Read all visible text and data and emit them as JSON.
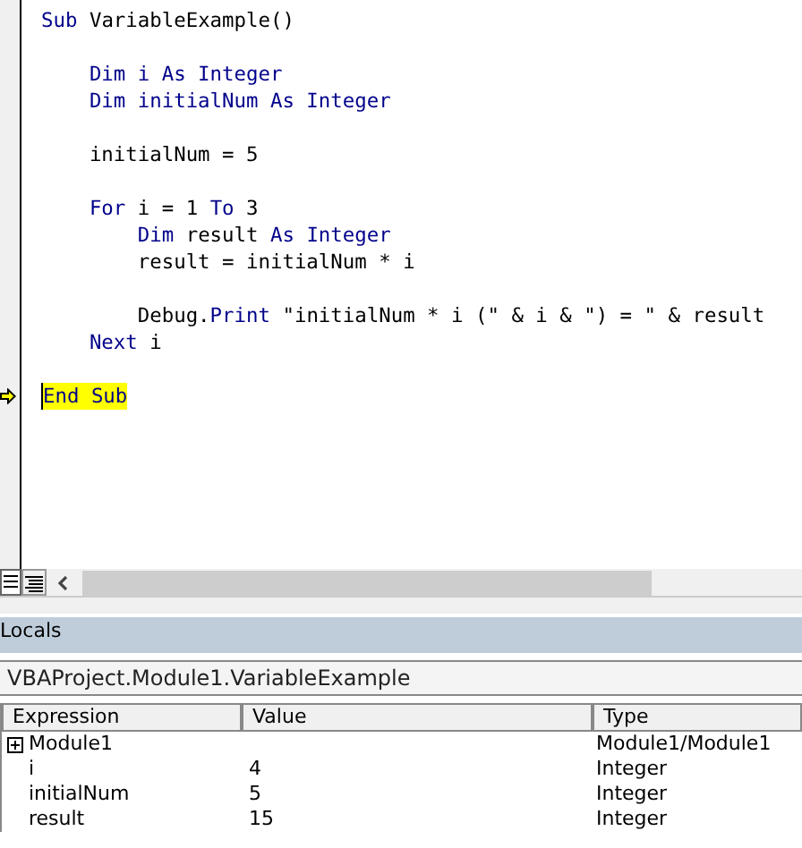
{
  "code_lines": [
    {
      "tokens": [
        {
          "text": "Sub",
          "kind": "kw"
        },
        {
          "text": " VariableExample()",
          "kind": "id"
        }
      ],
      "current": false
    },
    {
      "current": false
    },
    {
      "tokens": [
        {
          "text": "    Dim i As Integer",
          "kind": "kw"
        }
      ],
      "current": false
    },
    {
      "tokens": [
        {
          "text": "    Dim initialNum As Integer",
          "kind": "kw"
        }
      ],
      "current": false
    },
    {
      "current": false
    },
    {
      "tokens": [
        {
          "text": "    initialNum = 5",
          "kind": "id"
        }
      ],
      "current": false
    },
    {
      "current": false
    },
    {
      "tokens": [
        {
          "text": "    For",
          "kind": "kw"
        },
        {
          "text": " i = 1 ",
          "kind": "id"
        },
        {
          "text": "To",
          "kind": "kw"
        },
        {
          "text": " 3",
          "kind": "id"
        }
      ],
      "current": false
    },
    {
      "tokens": [
        {
          "text": "        Dim",
          "kind": "kw"
        },
        {
          "text": " result ",
          "kind": "id"
        },
        {
          "text": "As Integer",
          "kind": "kw"
        }
      ],
      "current": false
    },
    {
      "tokens": [
        {
          "text": "        result = initialNum * i",
          "kind": "id"
        }
      ],
      "current": false
    },
    {
      "current": false
    },
    {
      "tokens": [
        {
          "text": "        Debug.",
          "kind": "id"
        },
        {
          "text": "Print",
          "kind": "kw"
        },
        {
          "text": " \"initialNum * i (\" & i & \") = \" & result",
          "kind": "id"
        }
      ],
      "current": false
    },
    {
      "tokens": [
        {
          "text": "    Next",
          "kind": "kw"
        },
        {
          "text": " i",
          "kind": "id"
        }
      ],
      "current": false
    },
    {
      "current": false
    },
    {
      "tokens": [
        {
          "text": "End Sub",
          "kind": "kw"
        }
      ],
      "current": true
    }
  ],
  "locals": {
    "title": "Locals",
    "context": "VBAProject.Module1.VariableExample",
    "columns": [
      "Expression",
      "Value",
      "Type"
    ],
    "rows": [
      {
        "expression": "Module1",
        "type": "Module1/Module1",
        "expandable": true
      },
      {
        "expression": "i",
        "value": "4",
        "type": "Integer",
        "expandable": false
      },
      {
        "expression": "initialNum",
        "value": "5",
        "type": "Integer",
        "expandable": false
      },
      {
        "expression": "result",
        "value": "15",
        "type": "Integer",
        "expandable": false
      }
    ]
  }
}
